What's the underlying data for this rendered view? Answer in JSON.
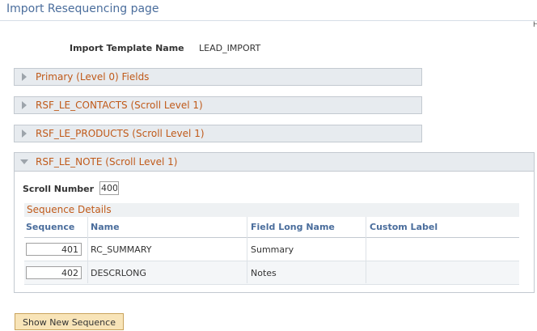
{
  "page": {
    "title": "Import Resequencing page",
    "corner_mark": "H"
  },
  "template": {
    "label": "Import Template Name",
    "value": "LEAD_IMPORT"
  },
  "collapsed_groups": [
    {
      "label": "Primary (Level 0) Fields"
    },
    {
      "label": "RSF_LE_CONTACTS (Scroll Level 1)"
    },
    {
      "label": "RSF_LE_PRODUCTS (Scroll Level 1)"
    }
  ],
  "expanded_group": {
    "label": "RSF_LE_NOTE (Scroll Level 1)",
    "scroll_label": "Scroll Number",
    "scroll_value": "400",
    "grid_title": "Sequence Details",
    "columns": [
      "Sequence",
      "Name",
      "Field Long Name",
      "Custom Label"
    ],
    "rows": [
      {
        "sequence": "401",
        "name": "RC_SUMMARY",
        "long_name": "Summary",
        "custom_label": ""
      },
      {
        "sequence": "402",
        "name": "DESCRLONG",
        "long_name": "Notes",
        "custom_label": ""
      }
    ]
  },
  "actions": {
    "show_new_sequence": "Show New Sequence"
  }
}
